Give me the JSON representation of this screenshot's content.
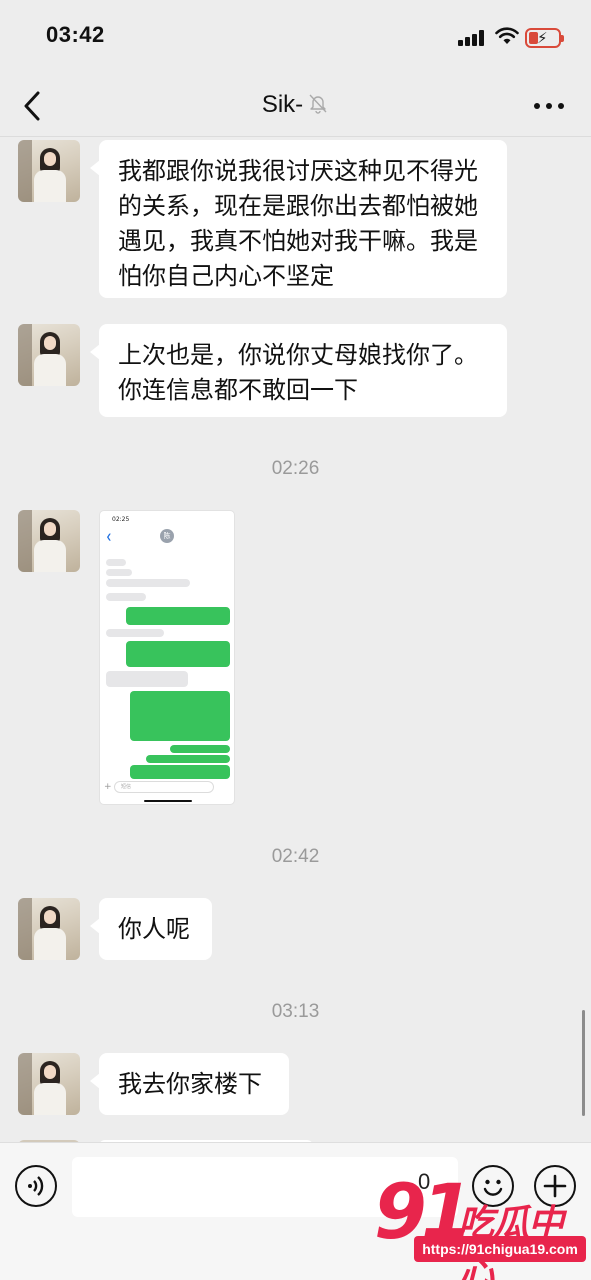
{
  "status_bar": {
    "time": "03:42"
  },
  "nav": {
    "title": "Sik-"
  },
  "messages": [
    {
      "type": "text",
      "text": "我都跟你说我很讨厌这种见不得光的关系，现在是跟你出去都怕被她遇见，我真不怕她对我干嘛。我是怕你自己内心不坚定"
    },
    {
      "type": "text",
      "text": "上次也是，你说你丈母娘找你了。你连信息都不敢回一下"
    },
    {
      "type": "timestamp",
      "text": "02:26"
    },
    {
      "type": "image",
      "description_icon": "screenshot-image"
    },
    {
      "type": "timestamp",
      "text": "02:42"
    },
    {
      "type": "text",
      "text": "你人呢"
    },
    {
      "type": "timestamp",
      "text": "03:13"
    },
    {
      "type": "text",
      "text": "我去你家楼下"
    }
  ],
  "embedded_screenshot": {
    "time": "02:25",
    "avatar_char": "陈",
    "input_placeholder": "短信"
  },
  "input_bar": {
    "value": "",
    "count": "0"
  },
  "watermark": {
    "logo": "91",
    "name": "吃瓜中心",
    "url": "https://91chigua19.com"
  },
  "colors": {
    "background": "#ededed",
    "bubble": "#ffffff",
    "sms_green": "#38c35c",
    "watermark_red": "#e8254c",
    "battery_red": "#d94a3a"
  }
}
